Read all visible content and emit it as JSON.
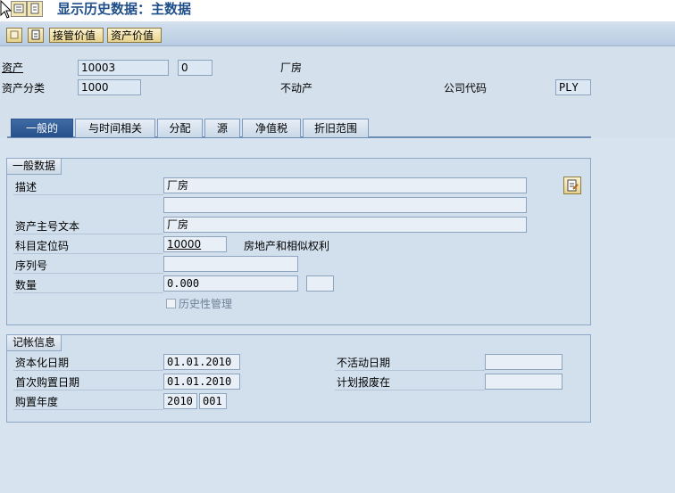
{
  "window": {
    "title": "显示历史数据：主数据"
  },
  "toolbar": {
    "btn_takeover": "接管价值",
    "btn_asset_value": "资产价值"
  },
  "header": {
    "asset_label": "资产",
    "asset_number": "10003",
    "asset_subnumber": "0",
    "asset_desc": "厂房",
    "asset_class_label": "资产分类",
    "asset_class": "1000",
    "asset_class_desc": "不动产",
    "company_code_label": "公司代码",
    "company_code": "PLY"
  },
  "tabs": [
    {
      "label": "一般的",
      "active": true
    },
    {
      "label": "与时间相关",
      "active": false
    },
    {
      "label": "分配",
      "active": false
    },
    {
      "label": "源",
      "active": false
    },
    {
      "label": "净值税",
      "active": false
    },
    {
      "label": "折旧范围",
      "active": false
    }
  ],
  "general": {
    "title": "一般数据",
    "desc_label": "描述",
    "desc_value": "厂房",
    "desc_value2": "",
    "main_text_label": "资产主号文本",
    "main_text_value": "厂房",
    "account_det_label": "科目定位码",
    "account_det_value": "10000",
    "account_det_desc": "房地产和相似权利",
    "serial_label": "序列号",
    "serial_value": "",
    "quantity_label": "数量",
    "quantity_value": "0.000",
    "quantity_unit": "",
    "history_label": "历史性管理"
  },
  "posting": {
    "title": "记帐信息",
    "cap_date_label": "资本化日期",
    "cap_date_value": "01.01.2010",
    "first_acq_label": "首次购置日期",
    "first_acq_value": "01.01.2010",
    "acq_year_label": "购置年度",
    "acq_year_value": "2010",
    "acq_period_value": "001",
    "deactivation_label": "不活动日期",
    "deactivation_value": "",
    "retirement_label": "计划报废在",
    "retirement_value": ""
  }
}
